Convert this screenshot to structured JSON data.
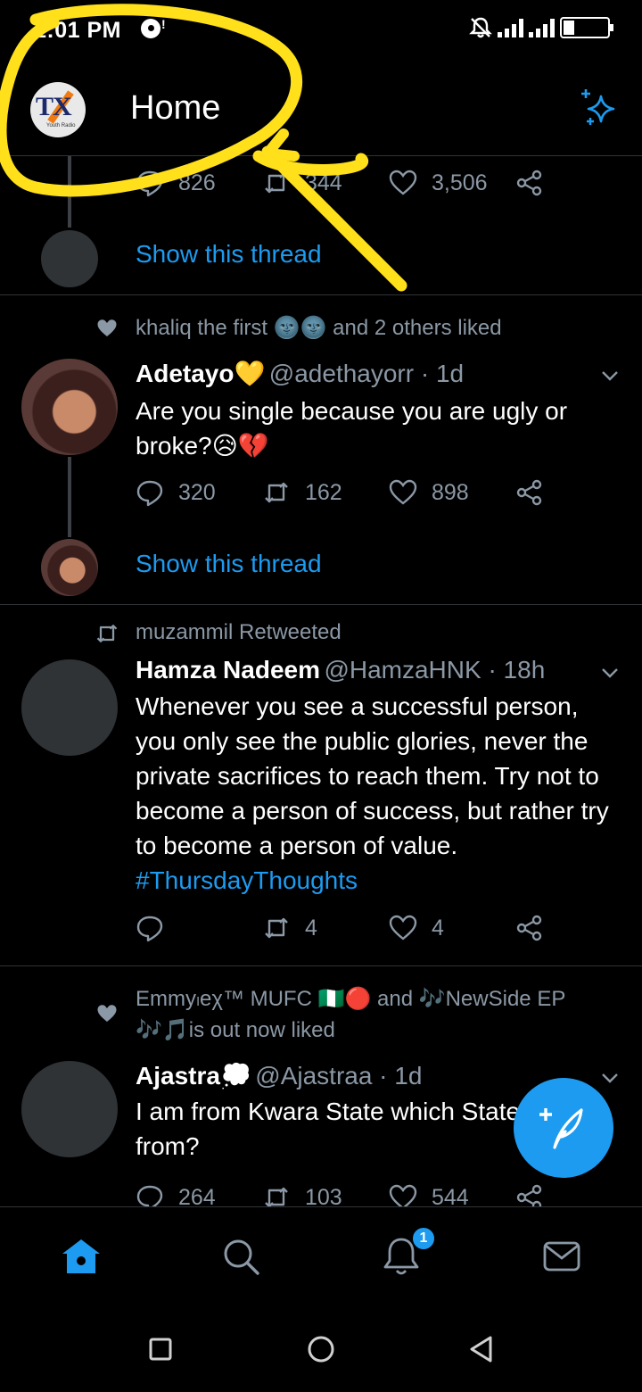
{
  "status_bar": {
    "time": "1:01 PM",
    "excl": "!"
  },
  "header": {
    "title": "Home",
    "logo_text": "TX",
    "logo_sub": "Youth Radio"
  },
  "colors": {
    "accent": "#1d9bf0",
    "background": "#000000",
    "muted": "#8b98a5",
    "annotation": "#ffe01a"
  },
  "top_partial": {
    "actions": {
      "replies": "826",
      "retweets": "344",
      "likes": "3,506"
    },
    "show_thread": "Show this thread"
  },
  "tweets": [
    {
      "context": "khaliq the first 🌚🌚 and 2 others liked",
      "name": "Adetayo💛",
      "handle": "@adethayorr · 1d",
      "text": "Are you single because you are ugly or broke?😥💔",
      "replies": "320",
      "retweets": "162",
      "likes": "898",
      "show_thread": "Show this thread"
    },
    {
      "context": "muzammil Retweeted",
      "name": "Hamza Nadeem",
      "handle": "@HamzaHNK · 18h",
      "text": "Whenever you see a successful person, you only see the public glories, never the private sacrifices to reach them. Try not to become a person of success, but rather try to become a person of value.",
      "hashtag": "#ThursdayThoughts",
      "replies": "",
      "retweets": "4",
      "likes": "4"
    },
    {
      "context_line1": "Emmyₗеχ™ MUFC 🇳🇬🔴 and 🎶NewSide EP",
      "context_line2": "🎶🎵is out now liked",
      "name": "Ajastra💭",
      "handle": "@Ajastraa · 1d",
      "text": "I am from Kwara State which State are you from?",
      "replies": "264",
      "retweets": "103",
      "likes": "544"
    }
  ],
  "bottom_nav": {
    "notification_count": "1"
  }
}
